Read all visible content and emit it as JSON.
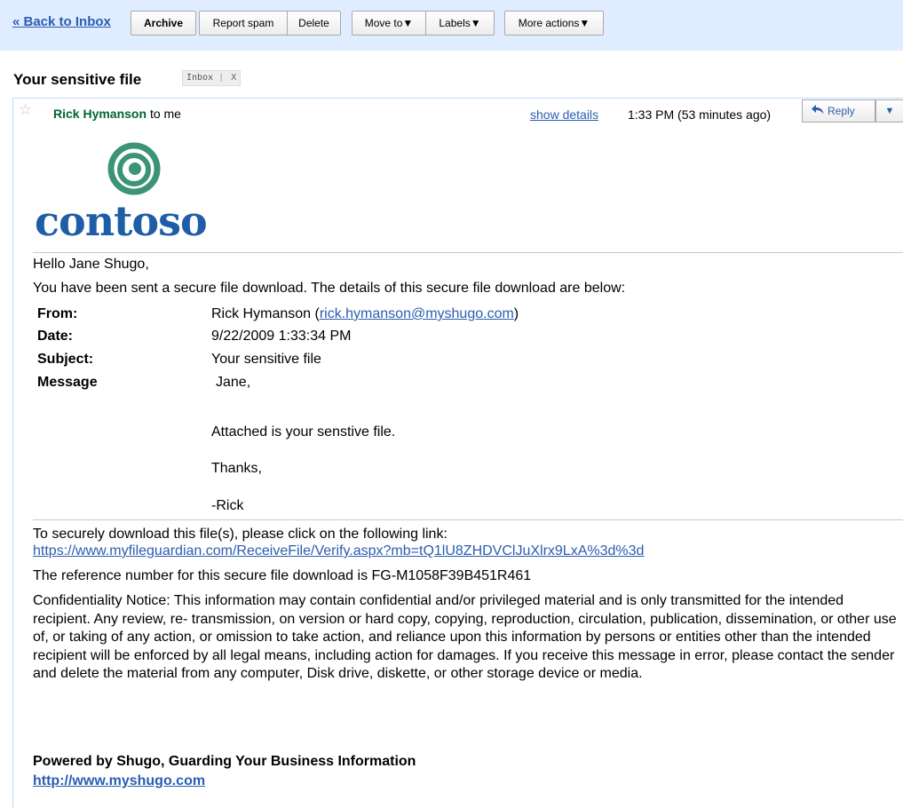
{
  "toolbar": {
    "back": "« Back to Inbox",
    "archive": "Archive",
    "report_spam": "Report spam",
    "delete": "Delete",
    "move_to": "Move to▼",
    "labels": "Labels▼",
    "more_actions": "More actions▼"
  },
  "thread": {
    "subject": "Your sensitive file",
    "label": "Inbox",
    "label_remove": "X"
  },
  "message": {
    "sender": "Rick Hymanson",
    "recipient": "to me",
    "show_details": "show details",
    "time": "1:33 PM (53 minutes ago)",
    "reply": "Reply",
    "reply_more": "▼"
  },
  "logo": {
    "text": "contoso"
  },
  "body": {
    "greeting": "Hello Jane Shugo,",
    "intro": "You have been sent a secure file download. The details of this secure file download are below:",
    "from_label": "From:",
    "from_name": "Rick Hymanson (",
    "from_email": "rick.hymanson@myshugo.com",
    "from_close": ")",
    "date_label": "Date:",
    "date_value": "9/22/2009 1:33:34 PM",
    "subject_label": "Subject:",
    "subject_value": "Your sensitive file",
    "message_label": "Message",
    "message_lines": [
      "Jane,",
      "Attached is your senstive file.",
      "Thanks,",
      "-Rick"
    ],
    "download_text": "To securely download this file(s), please click on the following link:",
    "download_link": "https://www.myfileguardian.com/ReceiveFile/Verify.aspx?mb=tQ1lU8ZHDVClJuXlrx9LxA%3d%3d",
    "reference": "The reference number for this secure file download is FG-M1058F39B451R461",
    "confidentiality": "Confidentiality Notice: This information may contain confidential and/or privileged material and is only transmitted for the intended recipient. Any review, re- transmission, on version or hard copy, copying, reproduction, circulation, publication, dissemination, or other use of, or taking of any action, or omission to take action, and reliance upon this information by persons or entities other than the intended recipient will be enforced by all legal means, including action for damages. If you receive this message in error, please contact the sender and delete the material from any computer, Disk drive, diskette, or other storage device or media.",
    "powered_by": "Powered by Shugo, Guarding Your Business Information",
    "powered_link": "http://www.myshugo.com"
  },
  "colors": {
    "toolbar_bg": "#e0ecff",
    "link": "#2a5db0",
    "sender": "#006633",
    "logo_green": "#3b9378",
    "logo_blue": "#1e5ea6"
  }
}
